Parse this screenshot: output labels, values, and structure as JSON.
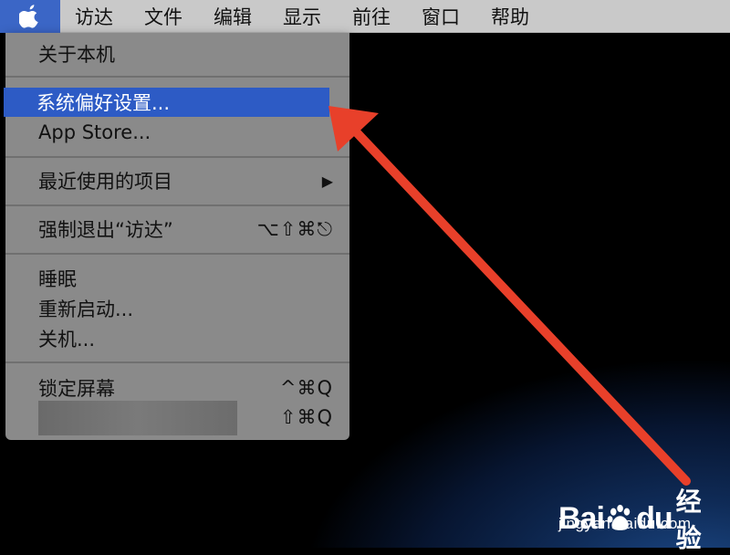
{
  "menubar": {
    "apple_icon": "apple-logo-icon",
    "items": [
      "访达",
      "文件",
      "编辑",
      "显示",
      "前往",
      "窗口",
      "帮助"
    ]
  },
  "apple_menu": {
    "about": "关于本机",
    "system_prefs": "系统偏好设置...",
    "app_store": "App Store...",
    "recent_items": "最近使用的项目",
    "recent_items_arrow": "▶",
    "force_quit": "强制退出“访达”",
    "force_quit_shortcut": "⌥⇧⌘⎋",
    "sleep": "睡眠",
    "restart": "重新启动...",
    "shutdown": "关机...",
    "lock_screen": "锁定屏幕",
    "lock_screen_shortcut": "^⌘Q",
    "logout_shortcut": "⇧⌘Q",
    "selected_item": "系统偏好设置..."
  },
  "colors": {
    "menubar_bg": "#c9c9c9",
    "apple_menu_highlight": "#3b66c6",
    "menu_bg": "#8a8a8a",
    "selected_bg": "#2d5bc5",
    "arrow": "#e8402a"
  },
  "watermark": {
    "logo_text_a": "Bai",
    "logo_text_b": "du",
    "logo_text_c": "经验",
    "url": "jingyan.baidu.com"
  }
}
